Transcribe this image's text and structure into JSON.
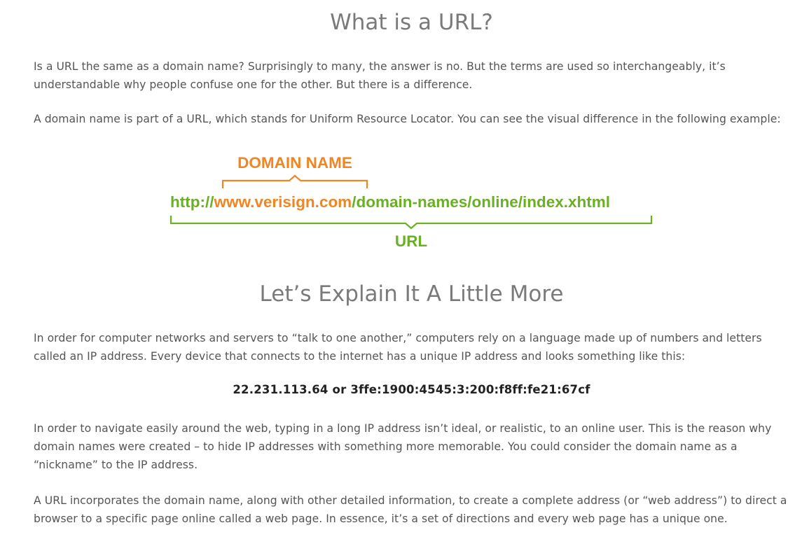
{
  "section1": {
    "title": "What is a URL?",
    "paragraphs": [
      "Is a URL the same as a domain name? Surprisingly to many, the answer is no. But the terms are used so interchangeably, it’s understandable why people confuse one for the other. But there is a difference.",
      "A domain name is part of a URL, which stands for Uniform Resource Locator. You can see the visual difference in the following example:"
    ]
  },
  "diagram": {
    "domain_label": "DOMAIN NAME",
    "url_prefix": "http://",
    "url_domain": "www.verisign.com",
    "url_path": "/domain-names/online/index.xhtml",
    "url_label": "URL",
    "colors": {
      "domain": "#f08522",
      "url": "#6ab023"
    }
  },
  "section2": {
    "title": "Let’s Explain It A Little More",
    "paragraphs": [
      "In order for computer networks and servers to “talk to one another,” computers rely on a language made up of numbers and letters called an IP address. Every device that connects to the internet has a unique IP address and looks something like this:",
      "In order to navigate easily around the web, typing in a long IP address isn’t ideal, or realistic, to an online user. This is the reason why domain names were created – to hide IP addresses with something more memorable. You could consider the domain name as a “nickname” to the IP address.",
      "A URL incorporates the domain name, along with other detailed information, to create a complete address (or “web address”) to direct a browser to a specific page online called a web page. In essence, it’s a set of directions and every web page has a unique one."
    ],
    "ip_example": "22.231.113.64 or 3ffe:1900:4545:3:200:f8ff:fe21:67cf"
  }
}
